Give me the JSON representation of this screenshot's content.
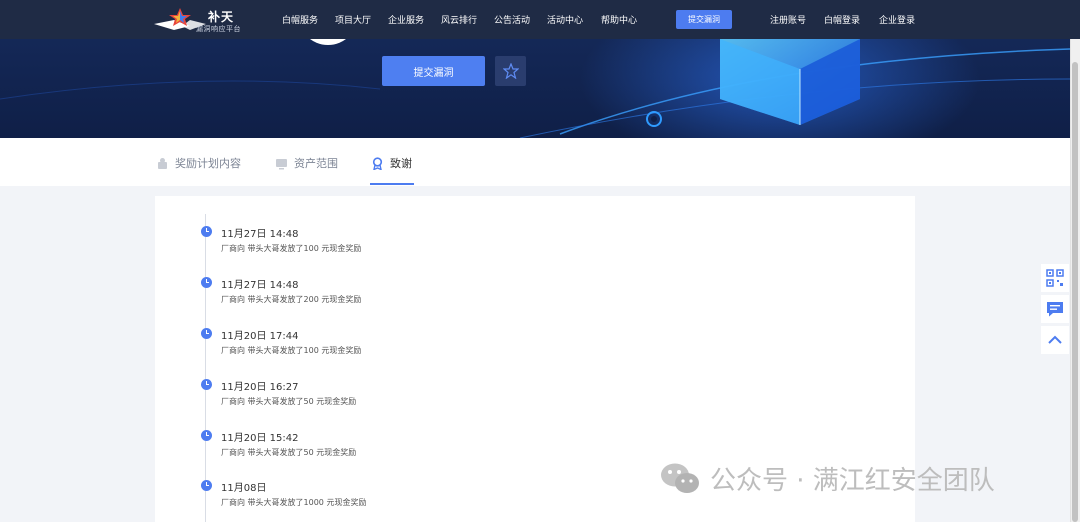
{
  "header": {
    "logo_title": "补天",
    "logo_subtitle": "漏洞响应平台",
    "nav": [
      "白帽服务",
      "项目大厅",
      "企业服务",
      "风云排行",
      "公告活动",
      "活动中心",
      "帮助中心"
    ],
    "submit_label": "提交漏洞",
    "auth": [
      "注册账号",
      "白帽登录",
      "企业登录"
    ]
  },
  "banner": {
    "submit_label": "提交漏洞"
  },
  "tabs": [
    {
      "label": "奖励计划内容",
      "active": false,
      "icon": "reward-icon"
    },
    {
      "label": "资产范围",
      "active": false,
      "icon": "asset-icon"
    },
    {
      "label": "致谢",
      "active": true,
      "icon": "medal-icon"
    }
  ],
  "timeline": [
    {
      "time": "11月27日 14:48",
      "desc": "厂商向 带头大哥发放了100 元现金奖励"
    },
    {
      "time": "11月27日 14:48",
      "desc": "厂商向 带头大哥发放了200 元现金奖励"
    },
    {
      "time": "11月20日 17:44",
      "desc": "厂商向 带头大哥发放了100 元现金奖励"
    },
    {
      "time": "11月20日 16:27",
      "desc": "厂商向 带头大哥发放了50 元现金奖励"
    },
    {
      "time": "11月20日 15:42",
      "desc": "厂商向 带头大哥发放了50 元现金奖励"
    },
    {
      "time": "11月08日",
      "desc": "厂商向 带头大哥发放了1000 元现金奖励"
    }
  ],
  "watermark": {
    "text": "公众号 · 满江红安全团队"
  },
  "colors": {
    "header_bg": "#1f2b45",
    "accent": "#4d7cf0",
    "banner_bg": "#142857"
  }
}
